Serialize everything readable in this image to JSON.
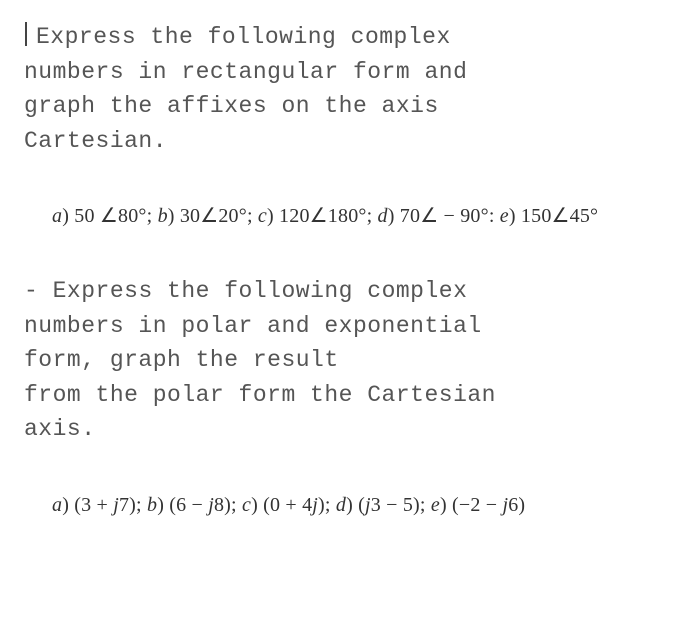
{
  "section1": {
    "bullet": "|-",
    "line1a": "Express the following complex",
    "line2": "numbers in rectangular form and",
    "line3": "graph the affixes on the axis",
    "line4": "Cartesian."
  },
  "math1": {
    "a_label": "a",
    "a_val": "50 ∠80°;",
    "b_label": "b",
    "b_val": "30∠20°;",
    "c_label": "c",
    "c_val": "120∠180°;",
    "d_label": "d",
    "d_val": "70∠ − 90°:",
    "e_label": "e",
    "e_val": "150∠45°"
  },
  "section2": {
    "bullet": "-",
    "line1a": "Express the following complex",
    "line2": "numbers in polar and exponential",
    "line3": "form, graph the result",
    "line4": "from the polar form the Cartesian",
    "line5": "axis."
  },
  "math2": {
    "a_label": "a",
    "a_val": "(3 + j7);",
    "b_label": "b",
    "b_val": "(6 − j8);",
    "c_label": "c",
    "c_val": "(0 + 4j);",
    "d_label": "d",
    "d_val": "(j3 − 5);",
    "e_label": "e",
    "e_val": "(−2 − j6)"
  }
}
